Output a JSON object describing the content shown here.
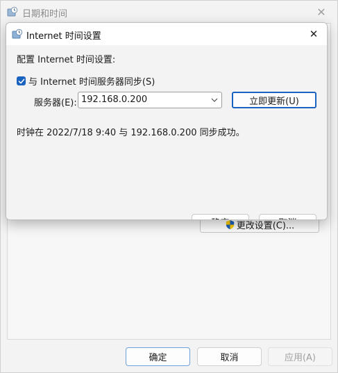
{
  "back_window": {
    "title": "日期和时间",
    "change_settings_label": "更改设置(C)...",
    "ok_label": "确定",
    "cancel_label": "取消",
    "apply_label": "应用(A)"
  },
  "dialog": {
    "title": "Internet 时间设置",
    "section_label": "配置 Internet 时间设置:",
    "sync_checkbox": {
      "label": "与 Internet 时间服务器同步(S)",
      "checked": true
    },
    "server_label": "服务器(E):",
    "server_value": "192.168.0.200",
    "update_now_label": "立即更新(U)",
    "status_text": "时钟在 2022/7/18 9:40 与 192.168.0.200 同步成功。",
    "ok_label": "确定",
    "cancel_label": "取消"
  },
  "icons": {
    "window": "clock-network-icon",
    "close": "close-icon",
    "shield": "uac-shield-icon",
    "dropdown": "chevron-down-icon",
    "check": "checkmark-icon"
  },
  "colors": {
    "accent": "#1a62c0",
    "window_bg": "#f3f3f3",
    "disabled_text": "#a0a0a0"
  }
}
